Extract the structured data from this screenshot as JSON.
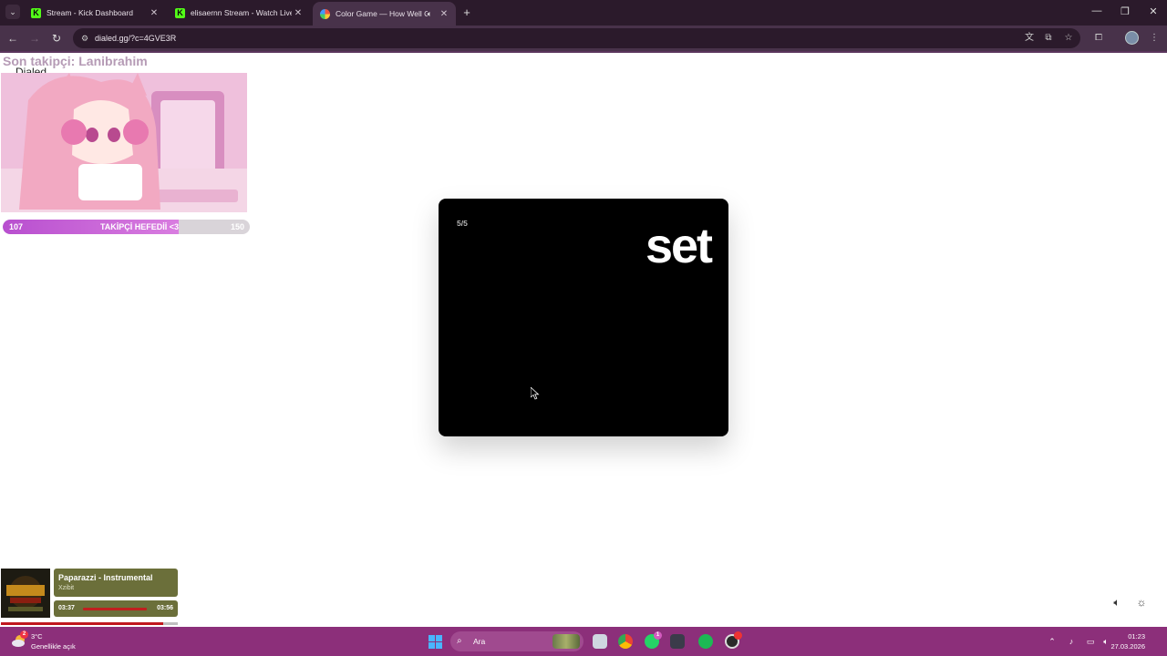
{
  "browser": {
    "tabs": [
      {
        "title": "Stream - Kick Dashboard",
        "favicon": "kick-icon",
        "active": false
      },
      {
        "title": "elisaernn Stream - Watch Live o",
        "favicon": "kick-icon",
        "active": false
      },
      {
        "title": "Color Game — How Well C",
        "favicon": "color-wheel-icon",
        "active": true,
        "audio": true
      }
    ],
    "tab_close_glyph": "✕",
    "new_tab_glyph": "+",
    "url": "dialed.gg/?c=4GVE3R",
    "window_controls": {
      "minimize": "—",
      "restore": "❐",
      "close": "✕"
    }
  },
  "overlay": {
    "follower_text": "Son takipçi: Lanibrahim",
    "brand_text": "Dialed",
    "goal": {
      "current": "107",
      "label": "TAKİPÇİ HEFEDİİ <3",
      "max": "150",
      "fraction": 0.713
    }
  },
  "game": {
    "counter": "5/5",
    "word": "set"
  },
  "now_playing": {
    "title": "Paparazzi - Instrumental",
    "artist": "Xzibit",
    "elapsed": "03:37",
    "duration": "03:56",
    "progress": 0.92
  },
  "taskbar": {
    "weather_badge": "2",
    "temperature": "3°C",
    "weather_desc": "Genellikle açık",
    "search_placeholder": "Ara",
    "whatsapp_badge": "1",
    "time": "01:23",
    "date": "27.03.2026"
  },
  "colors": {
    "card_bg": "#000000",
    "accent_pink": "#b84fcf",
    "taskbar_bg": "#8c2f7a",
    "chrome_bg": "#2b1a2b"
  }
}
